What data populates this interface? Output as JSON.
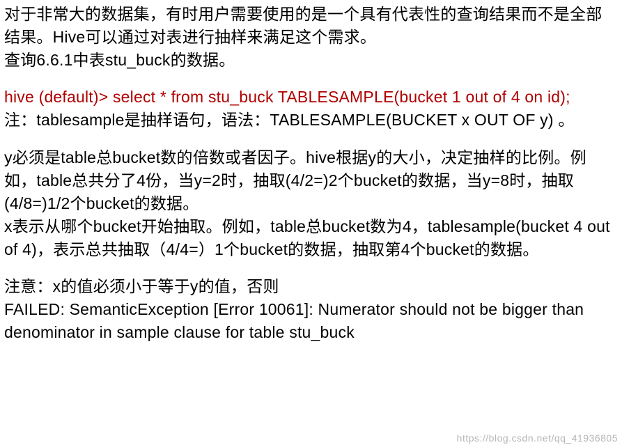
{
  "doc": {
    "p1a": "对于非常大的数据集，有时用户需要使用的是一个具有代表性的查询结果而不是全部结果。",
    "p1b": "Hive可以通过对表进行抽样来满足这个需求。",
    "p2a": "查询6.6.1中表",
    "p2b": "stu_buck",
    "p2c": "的数据。",
    "cmd_prompt": "hive (default)> select * from ",
    "cmd_table": "stu_buck",
    "cmd_tail": " TABLESAMPLE(bucket 1 out of 4 on id);",
    "p3a": "注：",
    "p3b": "tablesample",
    "p3c": "是抽样语句，语法：TABLESAMPLE(BUCKET x OUT OF y) 。",
    "p4": "y必须是table总bucket数的倍数或者因子。hive根据y的大小，决定抽样的比例。例如，table总共分了4份，当y=2时，抽取(4/2=)2个bucket的数据，当y=8时，抽取(4/8=)1/2个bucket的数据。",
    "p5a": "x表示从哪个bucket开始抽取。例如，table总bucket数为4，",
    "p5b": "tablesample",
    "p5c": "(bucket 4 out of 4)，表示总共抽取（4/4=）1个bucket的数据，抽取第4个bucket的数据。",
    "p6": "注意：x的值必须小于等于y的值，否则",
    "err_a": "FAILED: ",
    "err_b": "SemanticException",
    "err_c": " [Error 10061]: Numerator should not be bigger than denominator in sample clause for table ",
    "err_d": "stu_buck"
  },
  "watermark": "https://blog.csdn.net/qq_41936805"
}
